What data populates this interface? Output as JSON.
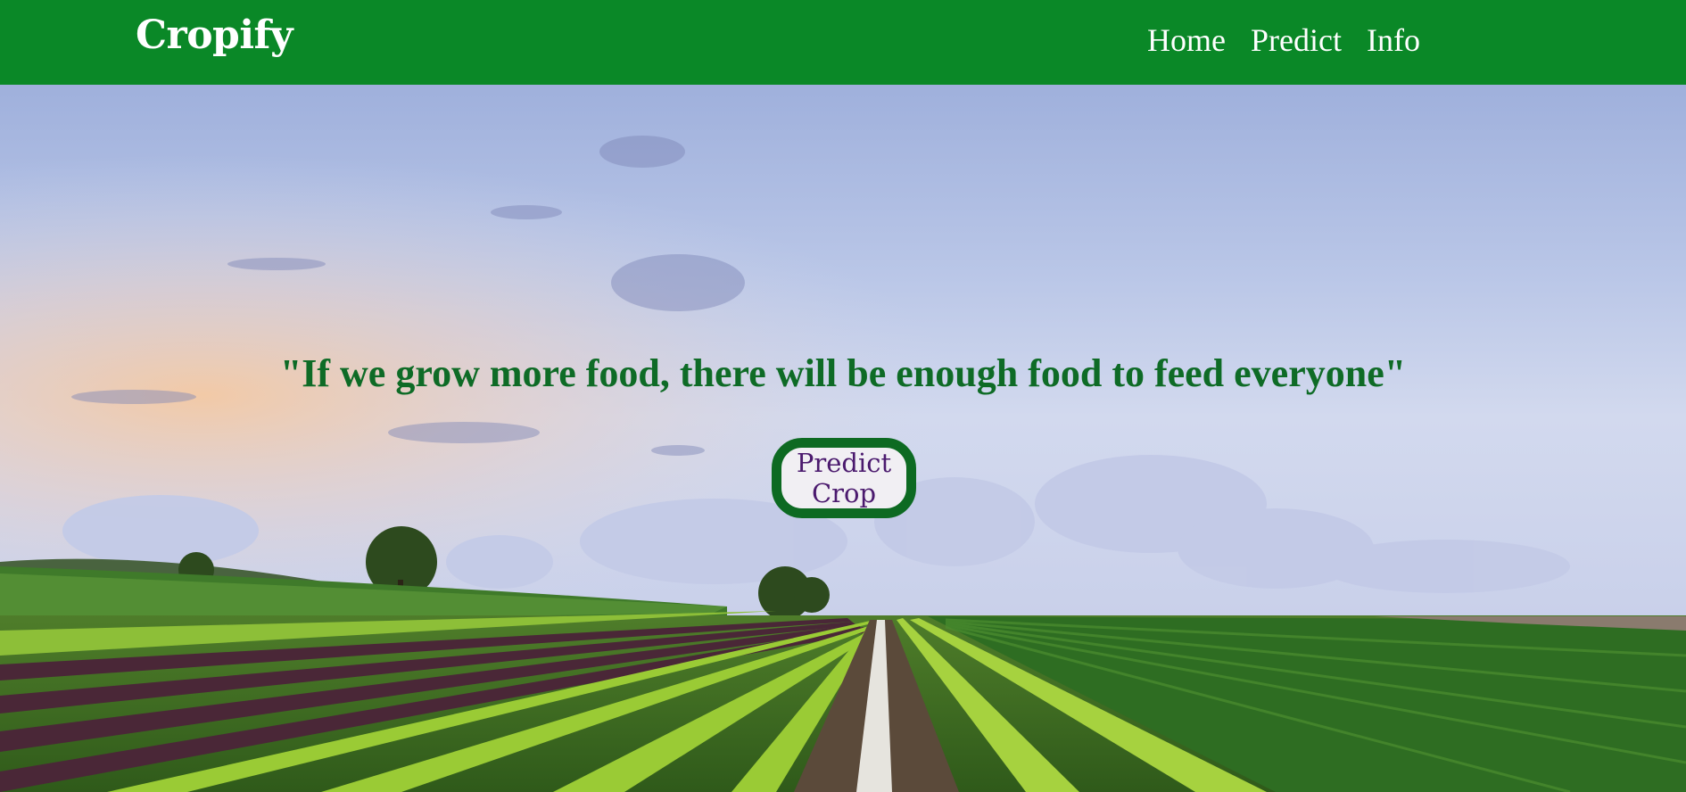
{
  "navbar": {
    "brand": "Cropify",
    "links": [
      {
        "label": "Home"
      },
      {
        "label": "Predict"
      },
      {
        "label": "Info"
      }
    ],
    "background_color": "#0a8827"
  },
  "hero": {
    "quote": "\"If we grow more food, there will be enough food to feed everyone\"",
    "quote_color": "#0e6b26",
    "cta_label": "Predict Crop",
    "cta_border_color": "#0d6a22",
    "cta_text_color": "#4b1a6e"
  }
}
